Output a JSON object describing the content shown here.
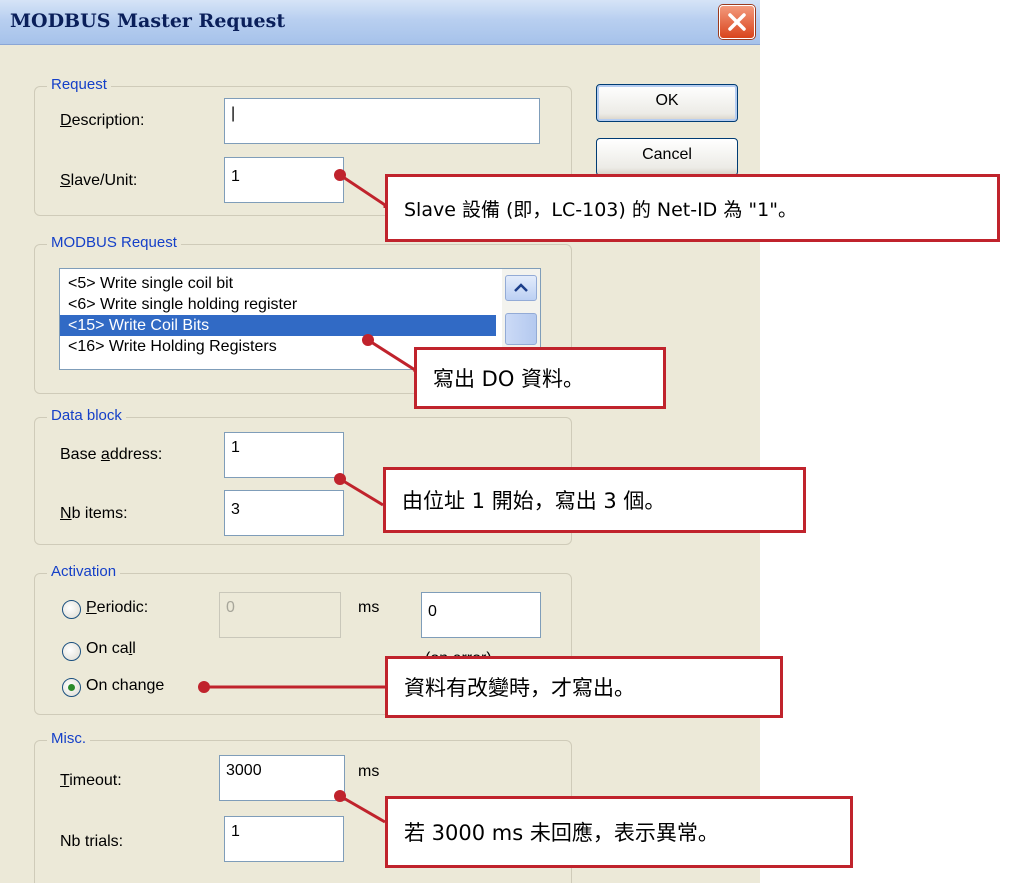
{
  "dialog": {
    "title": "MODBUS Master Request",
    "ok_label": "OK",
    "cancel_label": "Cancel"
  },
  "request": {
    "group_label": "Request",
    "description_label": "Description:",
    "description_value": "|",
    "slave_label": "Slave/Unit:",
    "slave_value": "1"
  },
  "modbus": {
    "group_label": "MODBUS Request",
    "items": [
      "<5> Write single coil bit",
      "<6> Write single holding register",
      "<15> Write Coil Bits",
      "<16> Write Holding Registers"
    ],
    "selected": "<15> Write Coil Bits"
  },
  "data_block": {
    "group_label": "Data block",
    "base_label": "Base address:",
    "base_value": "1",
    "nb_label": "Nb items:",
    "nb_value": "3"
  },
  "activation": {
    "group_label": "Activation",
    "periodic_label": "Periodic:",
    "periodic_value": "0",
    "ms_label": "ms",
    "error_value": "0",
    "on_error_label": "(on error)",
    "oncall_label": "On call",
    "onchange_label": "On change",
    "selected": "On change"
  },
  "misc": {
    "group_label": "Misc.",
    "timeout_label": "Timeout:",
    "timeout_value": "3000",
    "ms_label": "ms",
    "trials_label": "Nb trials:",
    "trials_value": "1"
  },
  "callouts": {
    "slave": "Slave 設備 (即，LC-103) 的 Net-ID 為 \"1\"。",
    "write_do": "寫出 DO 資料。",
    "address": "由位址 1 開始，寫出 3 個。",
    "on_change": "資料有改變時，才寫出。",
    "timeout": "若 3000 ms 未回應，表示異常。"
  },
  "colors": {
    "callout_border": "#c0232c",
    "selection": "#316ac5",
    "group_label": "#1540c8",
    "dialog_bg": "#ece9d8"
  }
}
